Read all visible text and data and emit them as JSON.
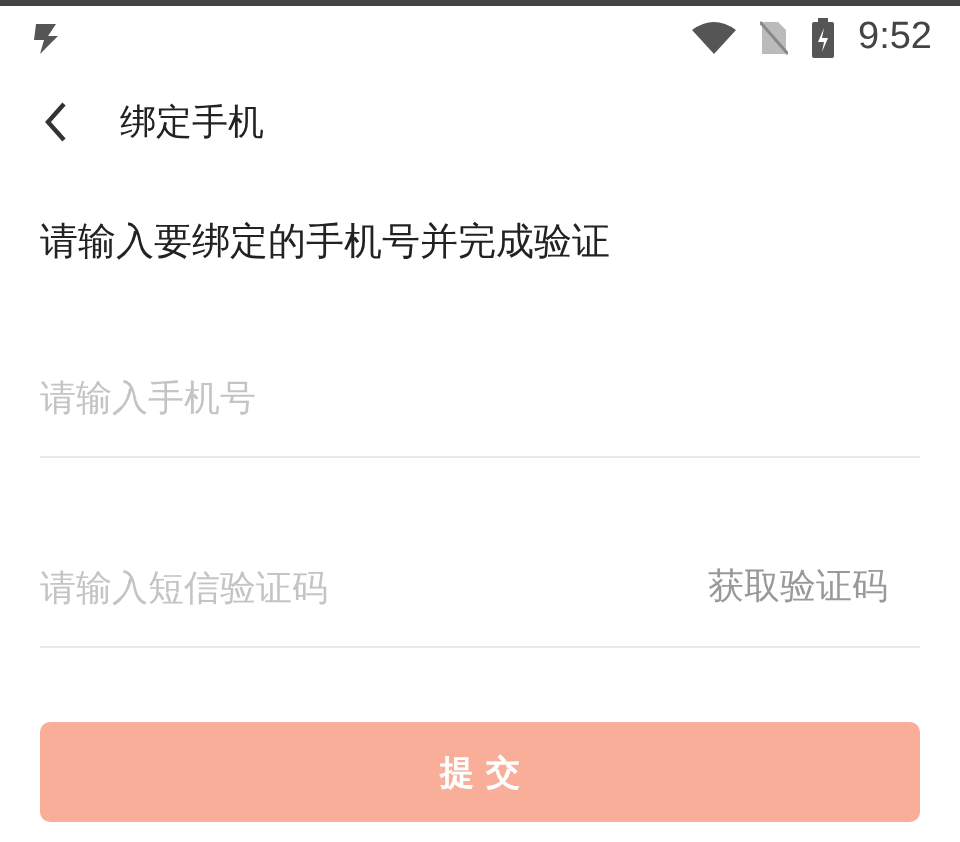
{
  "status_bar": {
    "time": "9:52"
  },
  "header": {
    "title": "绑定手机"
  },
  "instruction": "请输入要绑定的手机号并完成验证",
  "fields": [
    {
      "kind": "phone",
      "placeholder": "请输入手机号"
    },
    {
      "kind": "code",
      "placeholder": "请输入短信验证码",
      "action": "获取验证码"
    }
  ],
  "submit": {
    "label": "提 交",
    "disabled": true
  }
}
